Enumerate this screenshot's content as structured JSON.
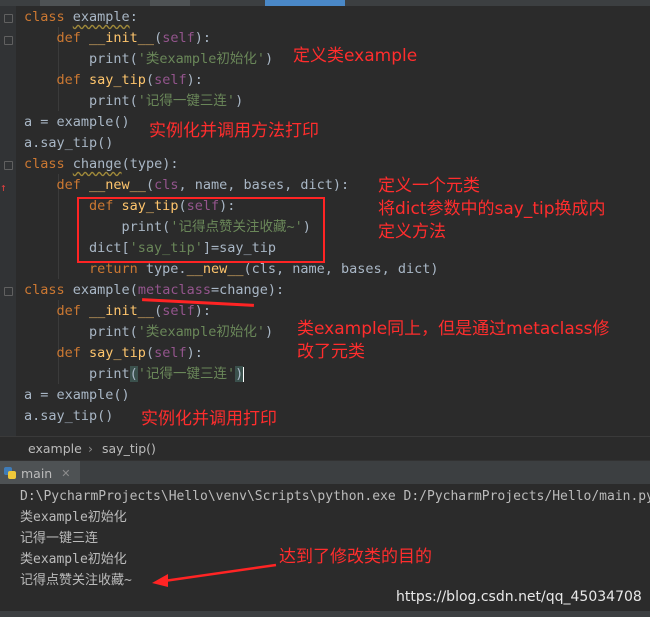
{
  "code_lines": [
    {
      "parts": [
        {
          "t": "class ",
          "c": "kw"
        },
        {
          "t": "example",
          "c": "warn"
        },
        {
          "t": ":",
          "c": ""
        }
      ]
    },
    {
      "parts": [
        {
          "t": "    def ",
          "c": "kw"
        },
        {
          "t": "__init__",
          "c": "fn"
        },
        {
          "t": "(",
          "c": ""
        },
        {
          "t": "self",
          "c": "self"
        },
        {
          "t": "):",
          "c": ""
        }
      ]
    },
    {
      "parts": [
        {
          "t": "        print(",
          "c": ""
        },
        {
          "t": "'类example初始化'",
          "c": "str"
        },
        {
          "t": ")",
          "c": ""
        }
      ]
    },
    {
      "parts": [
        {
          "t": "    def ",
          "c": "kw"
        },
        {
          "t": "say_tip",
          "c": "fn"
        },
        {
          "t": "(",
          "c": ""
        },
        {
          "t": "self",
          "c": "self"
        },
        {
          "t": "):",
          "c": ""
        }
      ]
    },
    {
      "parts": [
        {
          "t": "        print(",
          "c": ""
        },
        {
          "t": "'记得一键三连'",
          "c": "str"
        },
        {
          "t": ")",
          "c": ""
        }
      ]
    },
    {
      "parts": [
        {
          "t": "a = example()",
          "c": ""
        }
      ]
    },
    {
      "parts": [
        {
          "t": "a.say_tip()",
          "c": ""
        }
      ]
    },
    {
      "parts": [
        {
          "t": "class ",
          "c": "kw"
        },
        {
          "t": "change",
          "c": "warn"
        },
        {
          "t": "(type):",
          "c": ""
        }
      ]
    },
    {
      "parts": [
        {
          "t": "    def ",
          "c": "kw"
        },
        {
          "t": "__new__",
          "c": "fn"
        },
        {
          "t": "(",
          "c": ""
        },
        {
          "t": "cls",
          "c": "self"
        },
        {
          "t": ", name, bases, dict):",
          "c": ""
        }
      ]
    },
    {
      "parts": [
        {
          "t": "        def ",
          "c": "kw"
        },
        {
          "t": "say_tip",
          "c": "fn"
        },
        {
          "t": "(",
          "c": ""
        },
        {
          "t": "self",
          "c": "self"
        },
        {
          "t": "):",
          "c": ""
        }
      ]
    },
    {
      "parts": [
        {
          "t": "            print(",
          "c": ""
        },
        {
          "t": "'记得点赞关注收藏~'",
          "c": "str"
        },
        {
          "t": ")",
          "c": ""
        }
      ]
    },
    {
      "parts": [
        {
          "t": "        dict[",
          "c": ""
        },
        {
          "t": "'say_tip'",
          "c": "str"
        },
        {
          "t": "]=say_tip",
          "c": ""
        }
      ]
    },
    {
      "parts": [
        {
          "t": "        return ",
          "c": "kw"
        },
        {
          "t": "type.",
          "c": ""
        },
        {
          "t": "__new__",
          "c": "fn"
        },
        {
          "t": "(cls, name, bases, dict)",
          "c": ""
        }
      ]
    },
    {
      "parts": [
        {
          "t": "class ",
          "c": "kw"
        },
        {
          "t": "example",
          "c": ""
        },
        {
          "t": "(",
          "c": ""
        },
        {
          "t": "metaclass",
          "c": "self"
        },
        {
          "t": "=change):",
          "c": ""
        }
      ]
    },
    {
      "parts": [
        {
          "t": "    def ",
          "c": "kw"
        },
        {
          "t": "__init__",
          "c": "fn"
        },
        {
          "t": "(",
          "c": ""
        },
        {
          "t": "self",
          "c": "self"
        },
        {
          "t": "):",
          "c": ""
        }
      ]
    },
    {
      "parts": [
        {
          "t": "        print(",
          "c": ""
        },
        {
          "t": "'类example初始化'",
          "c": "str"
        },
        {
          "t": ")",
          "c": ""
        }
      ]
    },
    {
      "parts": [
        {
          "t": "    def ",
          "c": "kw"
        },
        {
          "t": "say_tip",
          "c": "fn"
        },
        {
          "t": "(",
          "c": ""
        },
        {
          "t": "self",
          "c": "self"
        },
        {
          "t": "):",
          "c": ""
        }
      ]
    },
    {
      "parts": [
        {
          "t": "        print",
          "c": ""
        },
        {
          "t": "(",
          "c": "hl"
        },
        {
          "t": "'记得一键三连'",
          "c": "str"
        },
        {
          "t": ")",
          "c": "hl"
        }
      ]
    },
    {
      "parts": [
        {
          "t": "a = example()",
          "c": ""
        }
      ]
    },
    {
      "parts": [
        {
          "t": "a.say_tip()",
          "c": ""
        }
      ]
    }
  ],
  "annotations": {
    "a1": "定义类example",
    "a2": "实例化并调用方法打印",
    "a3": "定义一个元类\n将dict参数中的say_tip换成内\n定义方法",
    "a4": "类example同上，但是通过metaclass修\n改了元类",
    "a5": "实例化并调用打印",
    "a6": "达到了修改类的目的"
  },
  "breadcrumb": {
    "item1": "example",
    "sep": "›",
    "item2": "say_tip()"
  },
  "run_tab": {
    "label": "main",
    "icon": "python-icon"
  },
  "console_lines": [
    "D:\\PycharmProjects\\Hello\\venv\\Scripts\\python.exe D:/PycharmProjects/Hello/main.py",
    "类example初始化",
    "记得一键三连",
    "类example初始化",
    "记得点赞关注收藏~"
  ],
  "watermark": "https://blog.csdn.net/qq_45034708"
}
